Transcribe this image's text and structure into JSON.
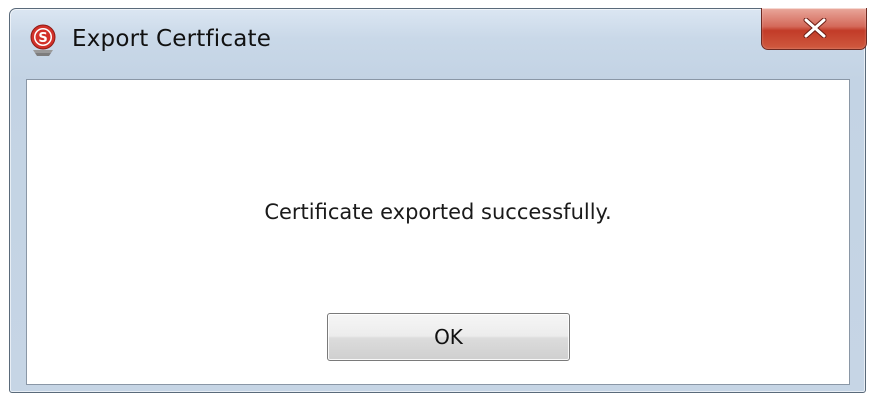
{
  "window": {
    "title": "Export Certficate",
    "app_icon": "app-logo-s-icon",
    "close_icon": "close-x-icon"
  },
  "dialog": {
    "message": "Certificate exported successfully.",
    "ok_label": "OK"
  },
  "colors": {
    "close_button": "#c94a36",
    "frame": "#c6d5e5",
    "app_icon_red": "#d2312a"
  }
}
